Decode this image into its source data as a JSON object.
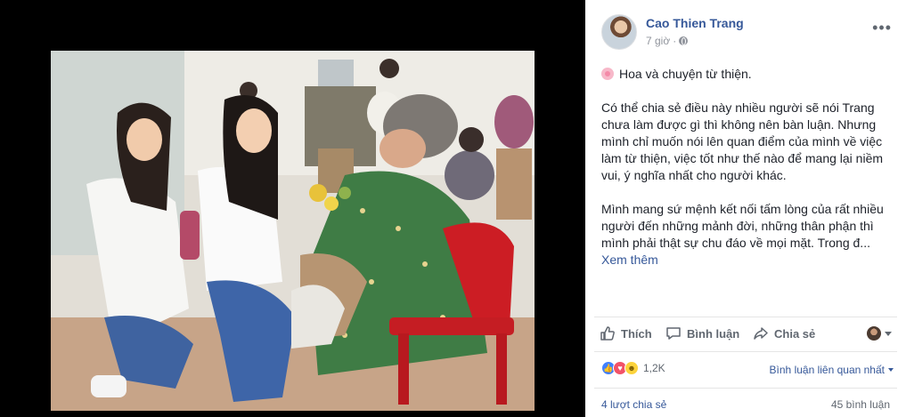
{
  "post": {
    "author": "Cao Thien Trang",
    "time": "7 giờ",
    "privacy_icon": "globe-icon",
    "menu": "•••",
    "text_line1": "Hoa và chuyện từ thiện.",
    "paragraph1": "Có thể chia sẻ điều này nhiều người sẽ nói Trang chưa làm được gì thì không nên bàn luận. Nhưng mình chỉ muốn nói lên quan điểm của mình về việc làm từ thiện, việc tốt như thế nào để mang lại niềm vui, ý nghĩa nhất cho người khác.",
    "paragraph2": "Mình mang sứ mệnh kết nối tấm lòng của rất nhiều người đến những mảnh đời, những thân phận thì mình phải thật sự chu đáo về mọi mặt. Trong đ...",
    "see_more": "Xem thêm"
  },
  "actions": {
    "like": "Thích",
    "comment": "Bình luận",
    "share": "Chia sẻ"
  },
  "reactions": {
    "count": "1,2K",
    "relevant": "Bình luận liên quan nhất"
  },
  "footer": {
    "shares": "4 lượt chia sẻ",
    "comments": "45 bình luận"
  },
  "colors": {
    "link": "#365899",
    "muted": "#90949c",
    "like": "#4080ff",
    "love": "#f25268",
    "haha": "#fcd33c"
  }
}
